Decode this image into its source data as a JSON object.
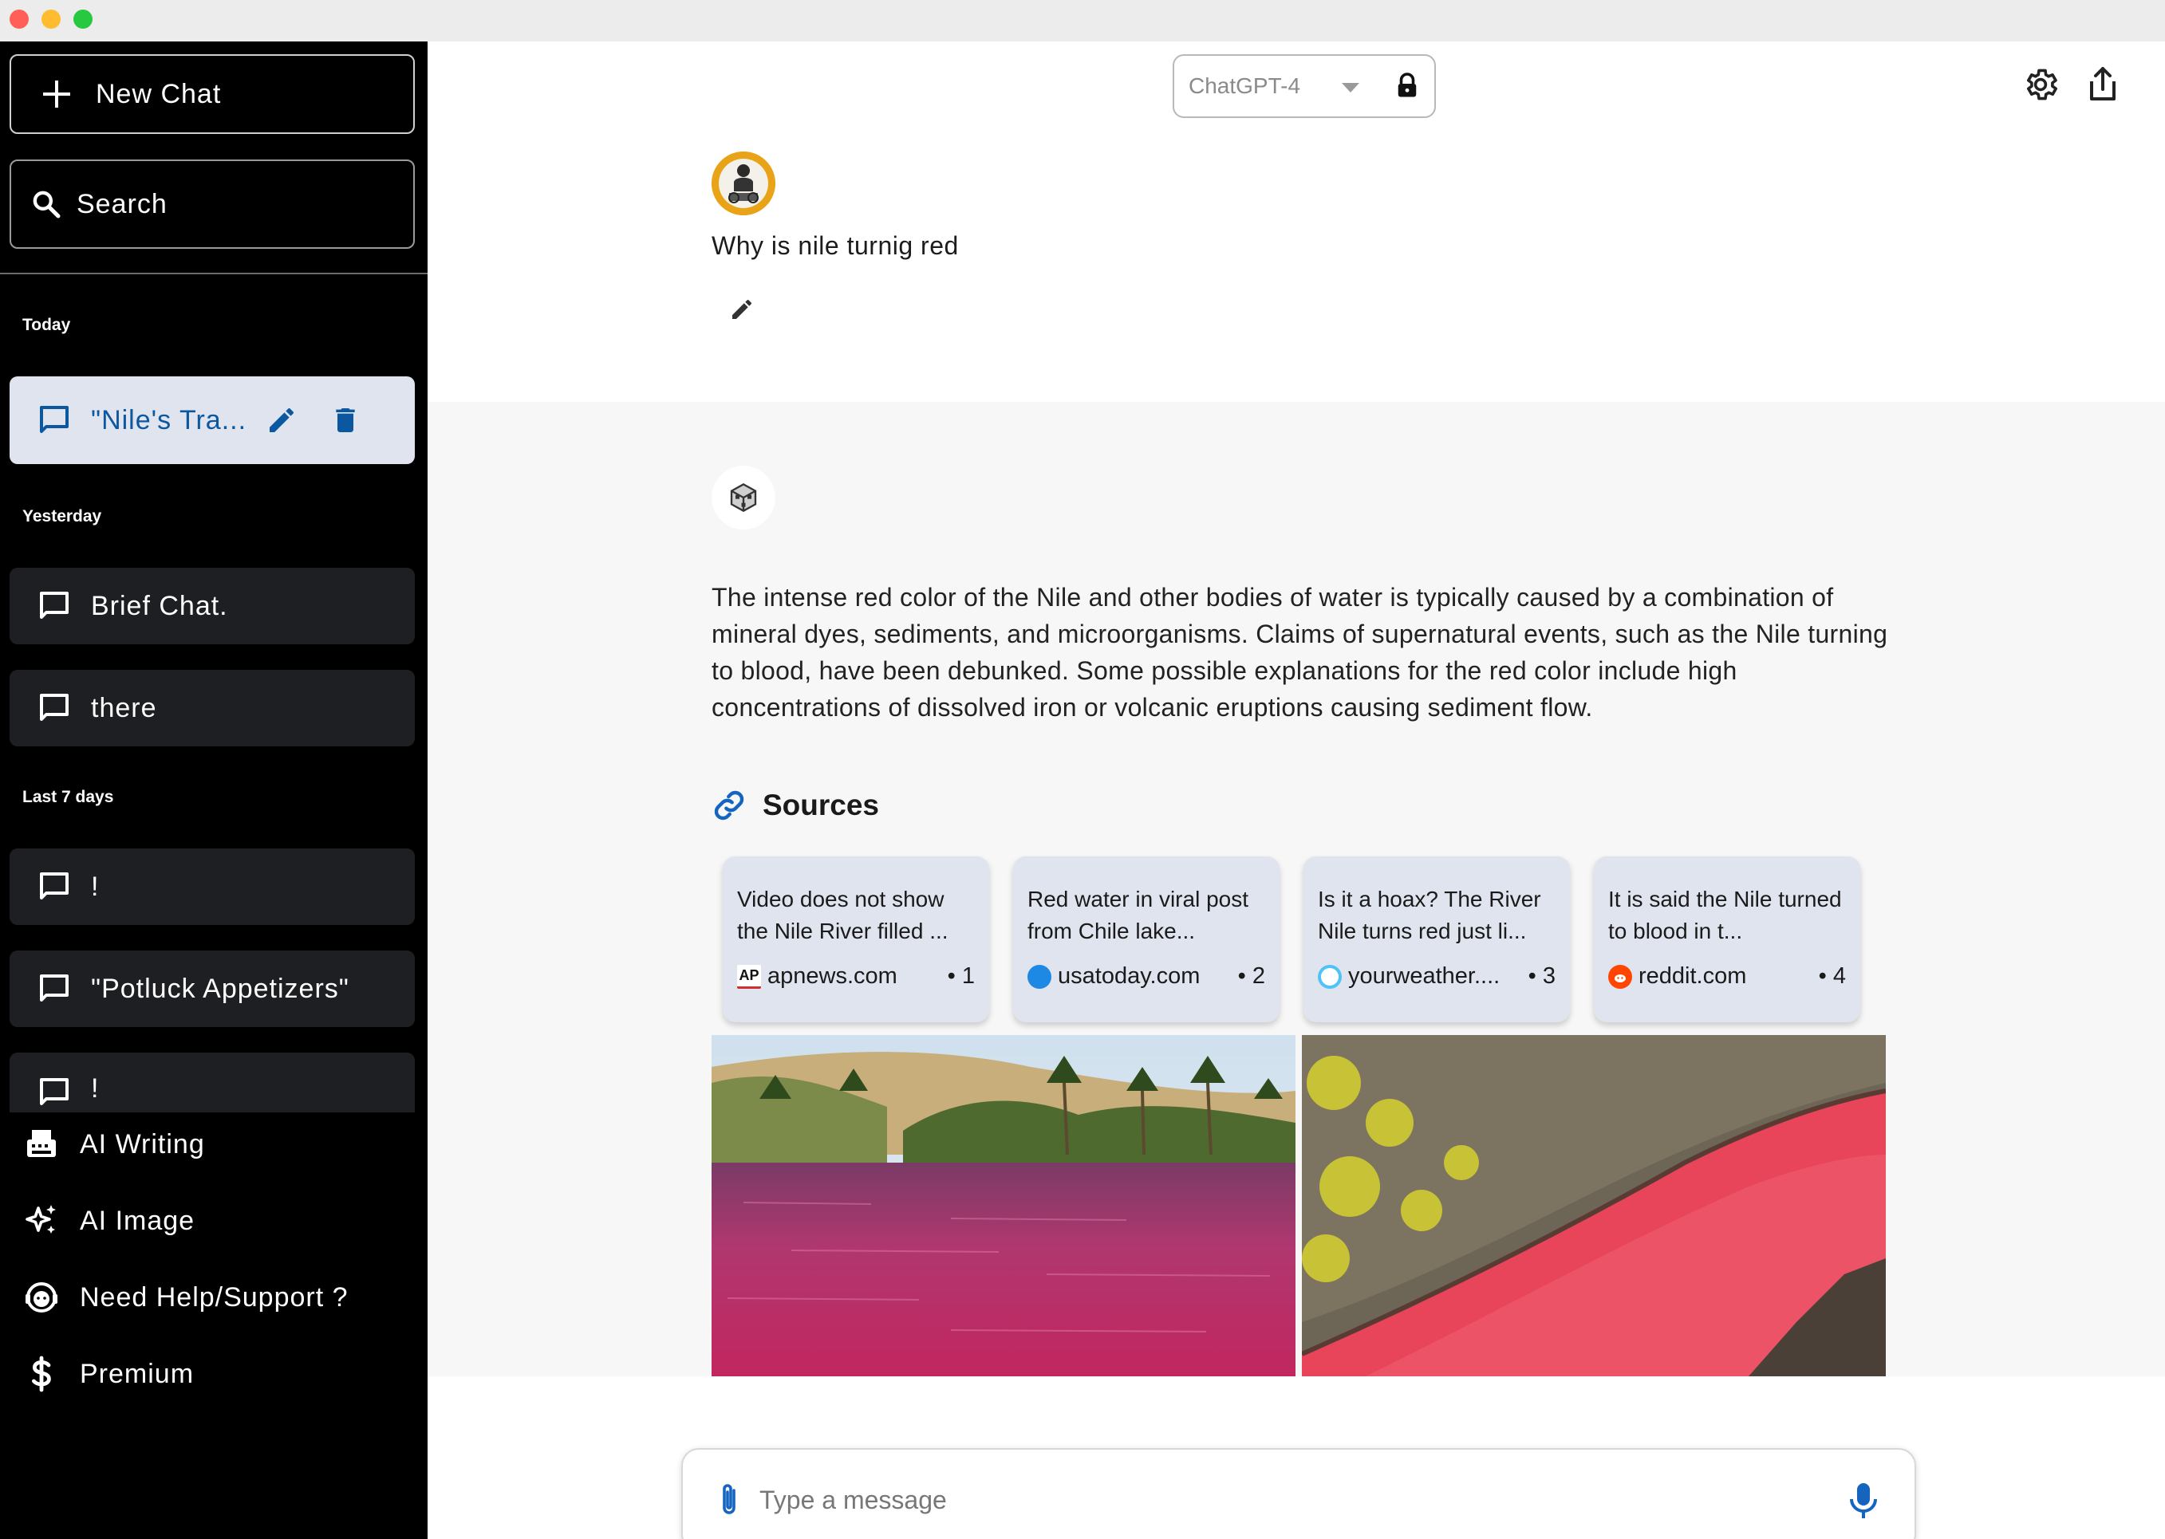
{
  "window": {
    "controls": [
      "close",
      "minimize",
      "maximize"
    ]
  },
  "sidebar": {
    "new_chat_label": "New Chat",
    "search_label": "Search",
    "groups": {
      "today": "Today",
      "yesterday": "Yesterday",
      "last7": "Last 7 days"
    },
    "chats": [
      {
        "label": "\"Nile's Tra...",
        "active": true
      },
      {
        "label": "Brief Chat."
      },
      {
        "label": "there"
      },
      {
        "label": "!"
      },
      {
        "label": "\"Potluck Appetizers\""
      },
      {
        "label": "!"
      }
    ],
    "menu": [
      {
        "label": "AI Writing",
        "icon": "typewriter-icon"
      },
      {
        "label": "AI Image",
        "icon": "sparkles-icon"
      },
      {
        "label": "Need Help/Support ?",
        "icon": "support-agent-icon"
      },
      {
        "label": "Premium",
        "icon": "dollar-icon"
      }
    ]
  },
  "header": {
    "model_value": "ChatGPT-4"
  },
  "conversation": {
    "user_message": "Why is nile turnig red",
    "assistant_message": "The intense red color of the Nile and other bodies of water is typically caused by a combination of mineral dyes, sediments, and microorganisms. Claims of supernatural events, such as the Nile turning to blood, have been debunked. Some possible explanations for the red color include high concentrations of dissolved iron or volcanic eruptions causing sediment flow.",
    "sources_title": "Sources",
    "sources": [
      {
        "title": "Video does not show the Nile River filled ...",
        "domain": "apnews.com",
        "index": "• 1",
        "favicon": "AP",
        "color": "#d32f2f"
      },
      {
        "title": "Red water in viral post from Chile lake...",
        "domain": "usatoday.com",
        "index": "• 2",
        "favicon": "",
        "color": "#1e88e5"
      },
      {
        "title": "Is it a hoax? The River Nile turns red just li...",
        "domain": "yourweather....",
        "index": "• 3",
        "favicon": "",
        "color": "#4fc3f7"
      },
      {
        "title": "It is said the Nile turned to blood in t...",
        "domain": "reddit.com",
        "index": "• 4",
        "favicon": "",
        "color": "#ff4500"
      }
    ]
  },
  "composer": {
    "placeholder": "Type a message"
  },
  "colors": {
    "sidebar_bg": "#000000",
    "chat_item_bg": "#1e1f23",
    "active_item_bg": "#dfe4ee",
    "accent_blue": "#0b57a0",
    "assistant_bg": "#f7f7f7"
  }
}
